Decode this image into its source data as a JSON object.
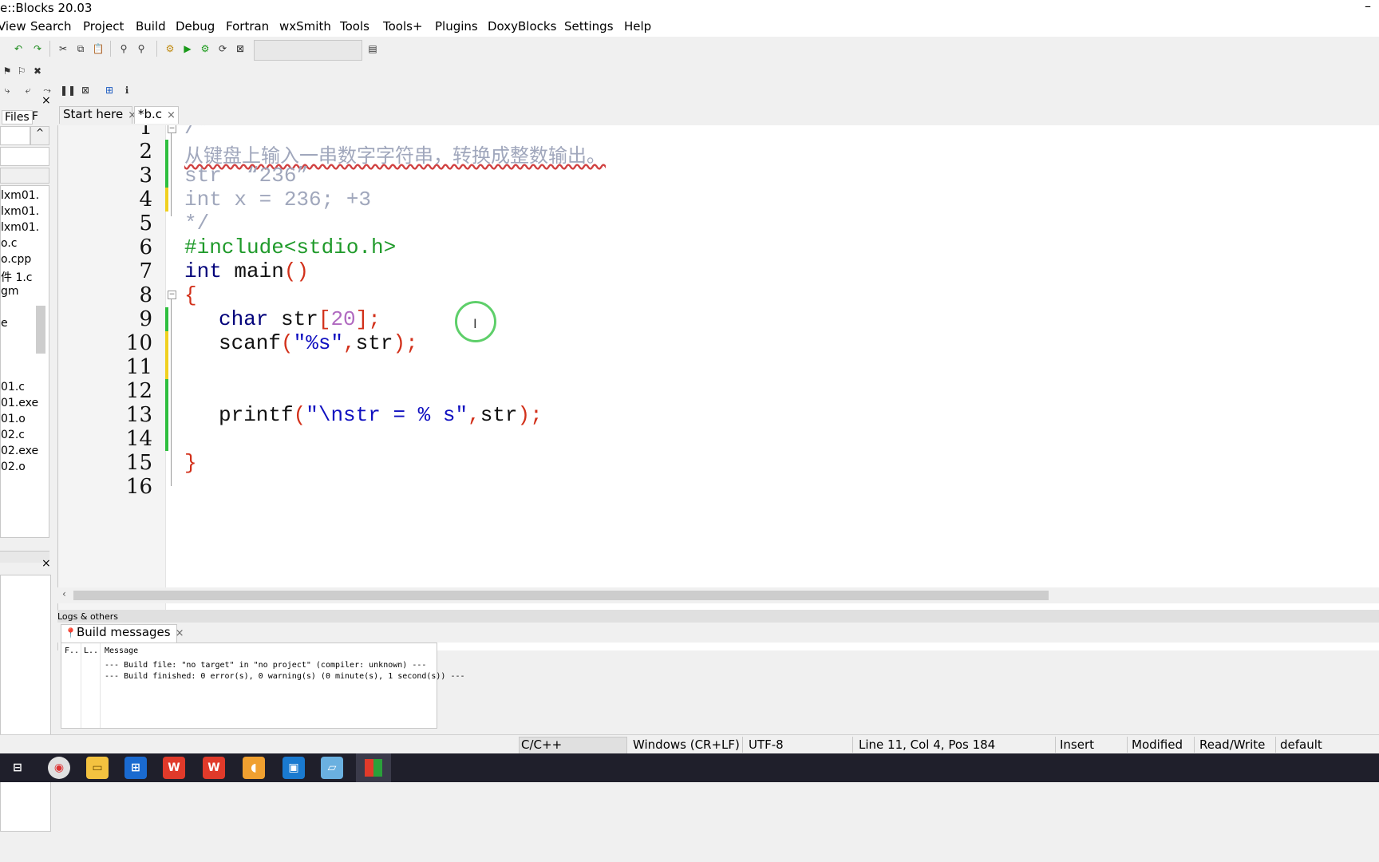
{
  "window": {
    "title": "e::Blocks 20.03",
    "minimize": "–"
  },
  "menu": [
    "View",
    "Search",
    "Project",
    "Build",
    "Debug",
    "Fortran",
    "wxSmith",
    "Tools",
    "Tools+",
    "Plugins",
    "DoxyBlocks",
    "Settings",
    "Help"
  ],
  "left_panel": {
    "tabs": [
      "Files",
      "F"
    ],
    "close": "×",
    "tree_items": [
      "lxm01.",
      "lxm01.",
      "lxm01.",
      "o.c",
      "o.cpp",
      "件 1.c",
      "gm",
      "e",
      "01.c",
      "01.exe",
      "01.o",
      "02.c",
      "02.exe",
      "02.o"
    ]
  },
  "editor": {
    "tabs": [
      {
        "label": "Start here",
        "close": "×"
      },
      {
        "label": "*b.c",
        "close": "×"
      }
    ],
    "line_numbers": [
      "1",
      "2",
      "3",
      "4",
      "5",
      "6",
      "7",
      "8",
      "9",
      "10",
      "11",
      "12",
      "13",
      "14",
      "15",
      "16"
    ],
    "code": {
      "l1": "/*",
      "l2": "从键盘上输入一串数字字符串，转换成整数输出。",
      "l3": "str  “236”",
      "l4": "int x = 236; +3",
      "l5": "*/",
      "l6": "#include<stdio.h>",
      "l7_kw": "int",
      "l7_rest": " main",
      "l7_paren": "()",
      "l8": "{",
      "l9_kw": "char",
      "l9_id": " str",
      "l9_b1": "[",
      "l9_num": "20",
      "l9_b2": "];",
      "l10_fn": "scanf",
      "l10_p1": "(",
      "l10_str": "\"%s\"",
      "l10_c": ",",
      "l10_id": "str",
      "l10_p2": ");",
      "l13_fn": "printf",
      "l13_p1": "(",
      "l13_str": "\"\\nstr = % s\"",
      "l13_c": ",",
      "l13_id": "str",
      "l13_p2": ");",
      "l15": "}"
    }
  },
  "logs": {
    "header": "Logs & others",
    "tab": "Build messages",
    "tab_close": "×",
    "columns": [
      "F..",
      "L..",
      "Message"
    ],
    "messages": [
      "--- Build file: \"no target\" in \"no project\" (compiler: unknown) ---",
      "--- Build finished: 0 error(s), 0 warning(s) (0 minute(s), 1 second(s)) ---"
    ]
  },
  "statusbar": {
    "lang": "C/C++",
    "eol": "Windows (CR+LF)",
    "encoding": "UTF-8",
    "position": "Line 11, Col 4, Pos 184",
    "mode": "Insert",
    "modified": "Modified",
    "access": "Read/Write",
    "profile": "default"
  },
  "taskbar": {
    "items": [
      "task-view-icon",
      "chrome-icon",
      "file-explorer-icon",
      "store-icon",
      "wps-writer-icon",
      "wps-office-icon",
      "acorn-icon",
      "video-icon",
      "notepad-icon",
      "codeblocks-icon"
    ]
  },
  "colors": {
    "comment": "#a0a7bc",
    "preprocessor": "#1f9a2a",
    "keyword": "#00007a",
    "number": "#b06ac0",
    "operator": "#d2301a",
    "string": "#1010c0",
    "change_saved": "#2fbf3f",
    "change_unsaved": "#f0d020"
  }
}
